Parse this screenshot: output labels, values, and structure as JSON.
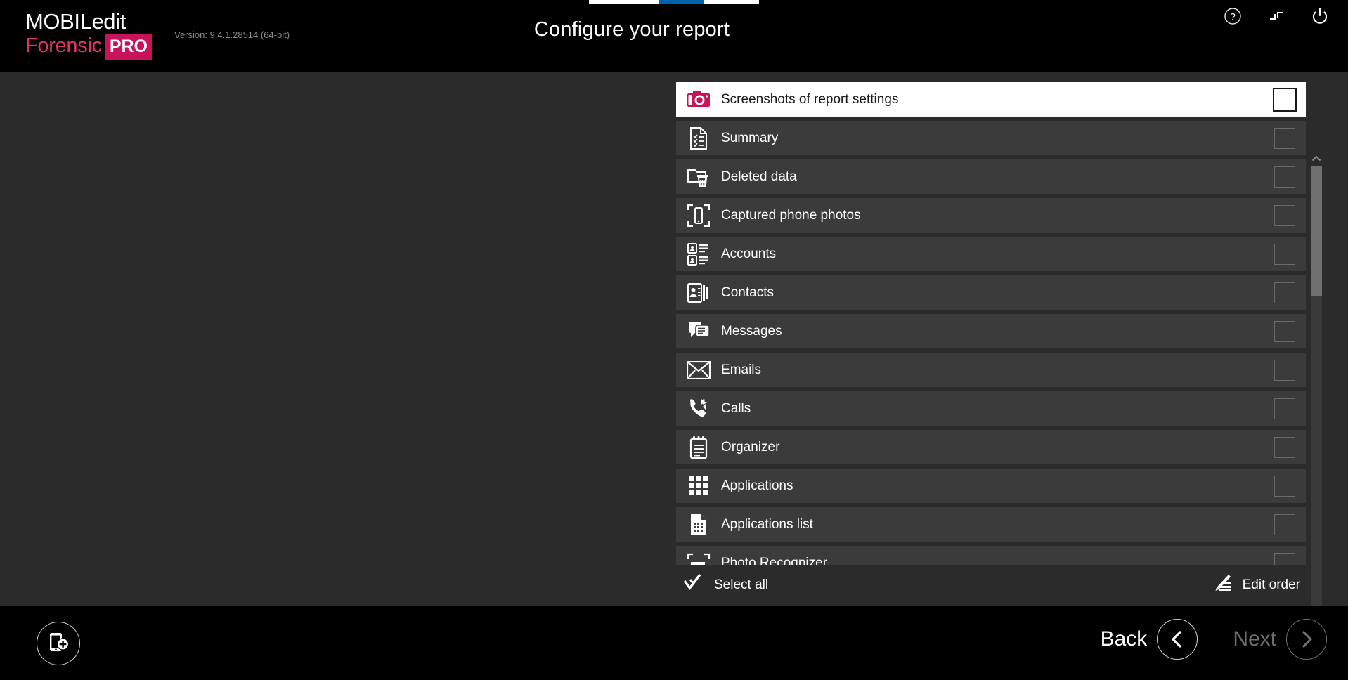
{
  "app": {
    "brand_line1": "MOBILedit",
    "brand_line2": "Forensic",
    "brand_badge": "PRO",
    "version": "Version: 9.4.1.28514 (64-bit)",
    "page_title": "Configure your report",
    "accent_crimson": "#c8125c",
    "accent_pink": "#e0336b",
    "accent_blue": "#0063b1",
    "panel_bg": "#2b2b2b",
    "row_bg": "#3b3b3b",
    "selected_row_bg": "#ffffff"
  },
  "header": {
    "icons": [
      {
        "name": "help-icon",
        "glyph": "?"
      },
      {
        "name": "minimize-icon",
        "glyph": "minimize"
      },
      {
        "name": "power-icon",
        "glyph": "power"
      }
    ]
  },
  "progress": {
    "total_steps": 4,
    "active_step": 2,
    "active_label": ""
  },
  "report_items": [
    {
      "label": "Screenshots of report settings",
      "icon": "camera-icon",
      "checked": false,
      "selected": true
    },
    {
      "label": "Summary",
      "icon": "summary-document-icon",
      "checked": false,
      "selected": false
    },
    {
      "label": "Deleted data",
      "icon": "deleted-folder-trash-icon",
      "checked": false,
      "selected": false
    },
    {
      "label": "Captured phone photos",
      "icon": "phone-capture-icon",
      "checked": false,
      "selected": false
    },
    {
      "label": "Accounts",
      "icon": "accounts-cards-icon",
      "checked": false,
      "selected": false
    },
    {
      "label": "Contacts",
      "icon": "contacts-card-icon",
      "checked": false,
      "selected": false
    },
    {
      "label": "Messages",
      "icon": "messages-bubble-icon",
      "checked": false,
      "selected": false
    },
    {
      "label": "Emails",
      "icon": "email-envelope-icon",
      "checked": false,
      "selected": false
    },
    {
      "label": "Calls",
      "icon": "calls-handset-icon",
      "checked": false,
      "selected": false
    },
    {
      "label": "Organizer",
      "icon": "organizer-notepad-icon",
      "checked": false,
      "selected": false
    },
    {
      "label": "Applications",
      "icon": "applications-grid-icon",
      "checked": false,
      "selected": false
    },
    {
      "label": "Applications list",
      "icon": "applications-list-icon",
      "checked": false,
      "selected": false
    },
    {
      "label": "Photo Recognizer",
      "icon": "photo-recognizer-gun-icon",
      "checked": false,
      "selected": false
    }
  ],
  "panel_tools": {
    "select_all": "Select all",
    "select_all_icon": "double-check-icon",
    "edit_order": "Edit order",
    "edit_order_icon": "edit-order-pencil-icon"
  },
  "footer": {
    "add_device_icon": "add-device-icon",
    "back_label": "Back",
    "next_label": "Next",
    "back_enabled": true,
    "next_enabled": false
  },
  "scrollbar": {
    "position": "top",
    "thumb_fraction": 0.29
  }
}
